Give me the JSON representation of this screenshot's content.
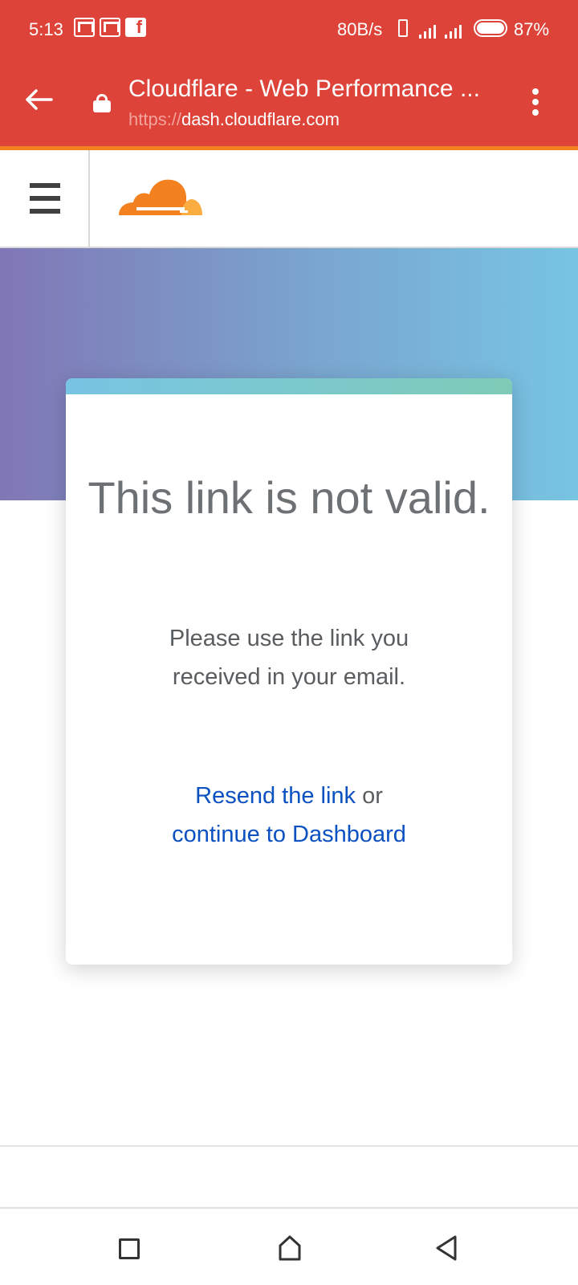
{
  "status_bar": {
    "time": "5:13",
    "net_speed": "80B/s",
    "battery": "87%",
    "notification_icons": [
      "gmail-icon",
      "gmail-icon",
      "facebook-icon"
    ]
  },
  "browser": {
    "page_title": "Cloudflare - Web Performance ...",
    "url_scheme": "https://",
    "url_host": "dash.cloudflare.com",
    "theme_color": "#dd4338"
  },
  "site_header": {
    "logo": "cloudflare-logo",
    "brand_color": "#f48120"
  },
  "card": {
    "heading": "This link is not valid.",
    "message": "Please use the link you received in your email.",
    "resend_link": "Resend the link",
    "connector": " or ",
    "dashboard_link": "continue to Dashboard",
    "link_color": "#0b51c1"
  },
  "nav_bar": {
    "buttons": [
      "recents-icon",
      "home-icon",
      "back-icon"
    ]
  }
}
